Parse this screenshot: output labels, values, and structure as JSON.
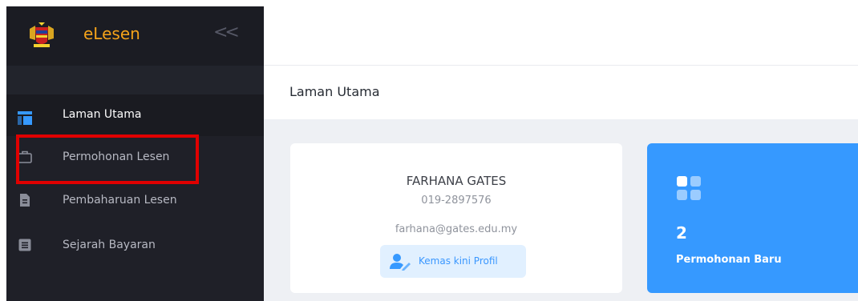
{
  "brand": {
    "name": "eLesen",
    "collapse_icon": "double-chevron-left-icon"
  },
  "sidebar": {
    "items": [
      {
        "label": "Laman Utama",
        "icon": "dashboard-icon",
        "active": true
      },
      {
        "label": "Permohonan Lesen",
        "icon": "briefcase-icon",
        "active": false
      },
      {
        "label": "Pembaharuan Lesen",
        "icon": "file-icon",
        "active": false
      },
      {
        "label": "Sejarah Bayaran",
        "icon": "list-icon",
        "active": false
      }
    ]
  },
  "page": {
    "title": "Laman Utama"
  },
  "profile": {
    "name": "FARHANA GATES",
    "phone": "019-2897576",
    "email": "farhana@gates.edu.my",
    "update_button": "Kemas kini Profil"
  },
  "stat": {
    "value": "2",
    "label": "Permohonan Baru",
    "icon": "apps-grid-icon"
  },
  "colors": {
    "accent": "#3699ff",
    "brand": "#f5a31a",
    "highlight": "#e00000",
    "sidebar": "#1f2028"
  }
}
